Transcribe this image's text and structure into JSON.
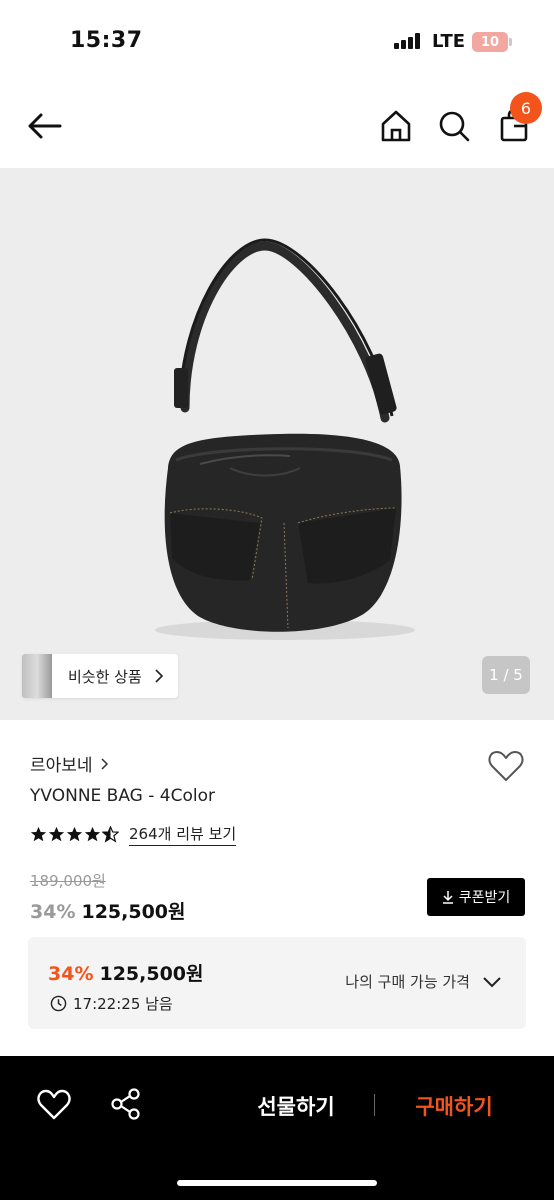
{
  "status_bar": {
    "time": "15:37",
    "network": "LTE",
    "battery": "10"
  },
  "nav": {
    "cart_count": "6"
  },
  "hero": {
    "similar_label": "비슷한 상품",
    "pager": "1 / 5"
  },
  "product": {
    "brand": "르아보네",
    "name": "YVONNE BAG - 4Color",
    "rating": 4.5,
    "review_link": "264개 리뷰 보기",
    "original_price": "189,000원",
    "discount": "34%",
    "price": "125,500원",
    "coupon_label": "쿠폰받기"
  },
  "my_price": {
    "discount": "34%",
    "price": "125,500원",
    "timer": "17:22:25 남음",
    "toggle_label": "나의 구매 가능 가격"
  },
  "bottom_bar": {
    "gift_label": "선물하기",
    "buy_label": "구매하기"
  },
  "colors": {
    "accent": "#f2541b",
    "badge": "#f2541b",
    "hero_bg": "#ededed"
  }
}
